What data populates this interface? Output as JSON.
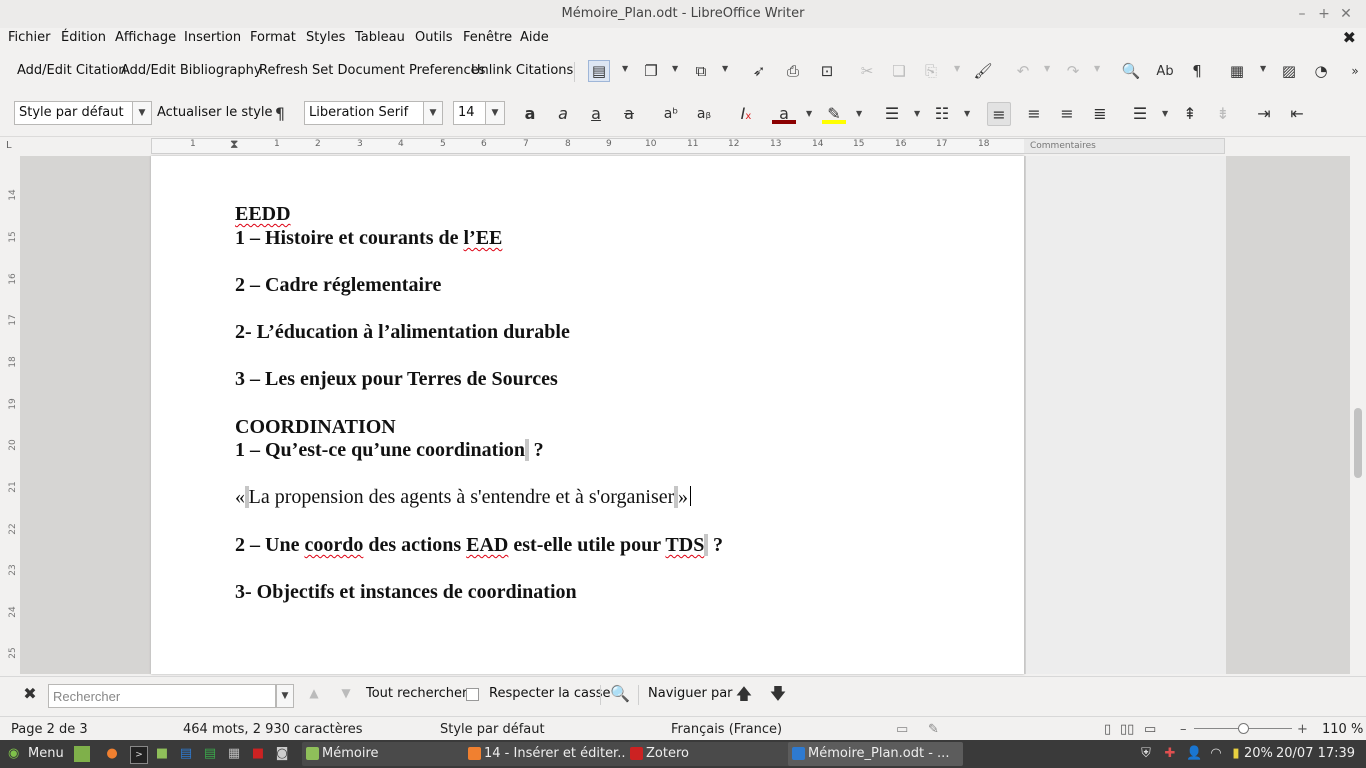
{
  "window": {
    "title": "Mémoire_Plan.odt - LibreOffice Writer"
  },
  "menu": [
    "Fichier",
    "Édition",
    "Affichage",
    "Insertion",
    "Format",
    "Styles",
    "Tableau",
    "Outils",
    "Fenêtre",
    "Aide"
  ],
  "zotero": {
    "add_citation": "Add/Edit Citation",
    "add_bibliography": "Add/Edit Bibliography",
    "refresh": "Refresh",
    "set_prefs": "Set Document Preferences",
    "unlink": "Unlink Citations"
  },
  "formatting": {
    "paragraph_style": "Style par défaut",
    "update_style": "Actualiser le style",
    "font_name": "Liberation Serif",
    "font_size": "14",
    "font_color": "#8b0000",
    "highlight_color": "#ffff00"
  },
  "ruler": {
    "numbers": [
      "1",
      "1",
      "2",
      "3",
      "4",
      "5",
      "6",
      "7",
      "8",
      "9",
      "10",
      "11",
      "12",
      "13",
      "14",
      "15",
      "16",
      "17",
      "18"
    ],
    "comments_label": "Commentaires"
  },
  "vruler_numbers": [
    "14",
    "15",
    "16",
    "17",
    "18",
    "19",
    "20",
    "21",
    "22",
    "23",
    "24",
    "25"
  ],
  "document": {
    "p1": "EEDD",
    "p2a": "1 – Histoire et courants de ",
    "p2b": "l’EE",
    "p3": "2 – Cadre réglementaire",
    "p4": "2- L’éducation à l’alimentation durable",
    "p5": "3 – Les enjeux pour Terres de Sources",
    "p6": "COORDINATION",
    "p7a": "1 – Qu’est-ce qu’une coordination",
    "p7b": "?",
    "p8a": "«",
    "p8b": "La propension des agents à s'entendre et à s'organiser",
    "p8c": "»",
    "p9a": "2 – Une ",
    "p9b": "coordo",
    "p9c": " des actions ",
    "p9d": "EAD",
    "p9e": " est-elle utile pour ",
    "p9f": "TDS",
    "p9g": "?",
    "p10": "3- Objectifs et instances de coordination"
  },
  "findbar": {
    "placeholder": "Rechercher",
    "find_all": "Tout rechercher",
    "match_case": "Respecter la casse",
    "navigate_by": "Naviguer par"
  },
  "status": {
    "page": "Page 2 de 3",
    "words": "464 mots, 2 930 caractères",
    "style": "Style par défaut",
    "language": "Français (France)",
    "zoom": "110 %"
  },
  "taskbar": {
    "menu": "Menu",
    "windows": [
      "Mémoire",
      "14 - Insérer et éditer...",
      "Zotero",
      "Mémoire_Plan.odt - ..."
    ],
    "battery": "20%",
    "clock": "20/07 17:39"
  }
}
